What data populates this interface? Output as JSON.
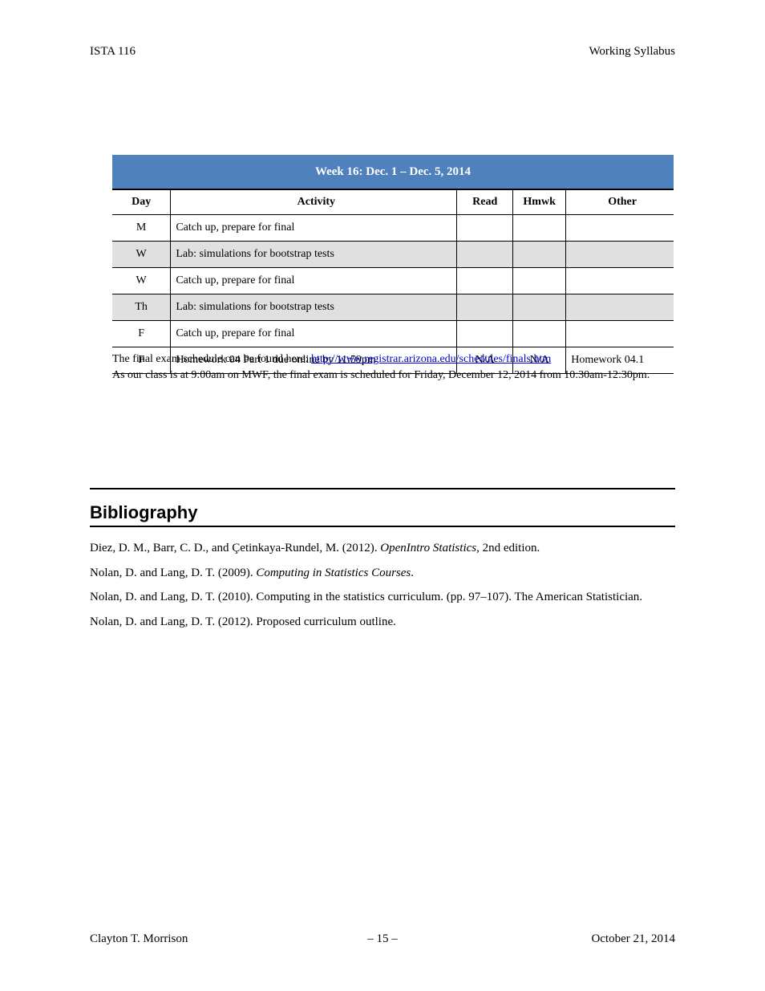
{
  "header": {
    "left": "ISTA 116",
    "right": "Working Syllabus"
  },
  "table": {
    "title": "Week 16: Dec. 1 – Dec. 5, 2014",
    "columns": [
      "Day",
      "Activity",
      "Read",
      "Hmwk",
      "Other"
    ],
    "rows": [
      {
        "day": "M",
        "activity": "Catch up, prepare for final",
        "read": "",
        "hmwk": "",
        "other": "",
        "shade": false
      },
      {
        "day": "W",
        "activity": "Lab: simulations for bootstrap tests",
        "read": "",
        "hmwk": "",
        "other": "",
        "shade": true
      },
      {
        "day": "W",
        "activity": "Catch up, prepare for final",
        "read": "",
        "hmwk": "",
        "other": "",
        "shade": false
      },
      {
        "day": "Th",
        "activity": "Lab: simulations for bootstrap tests",
        "read": "",
        "hmwk": "",
        "other": "",
        "shade": true
      },
      {
        "day": "F",
        "activity": "Catch up, prepare for final",
        "read": "",
        "hmwk": "",
        "other": "",
        "shade": false
      },
      {
        "day": "F",
        "activity": "Homework 04 Part 1 due online by 11:59pm",
        "read": "N/A",
        "hmwk": "N/A",
        "other": "Homework 04.1",
        "shade": false
      }
    ]
  },
  "note": {
    "line1_prefix": "The final exam schedule can be found here: ",
    "line1_link": "http://www.registrar.arizona.edu/schedules/finals.htm",
    "line2": "As our class is at 9:00am on MWF, the final exam is scheduled for Friday, December 12, 2014 from 10:30am-12:30pm."
  },
  "section_title": "Bibliography",
  "bib": {
    "e1_prefix": "Diez, D. M., Barr, C. D., and Çetinkaya-Rundel, M. (2012). ",
    "e1_title": "OpenIntro Statistics",
    "e1_suffix": ", 2nd edition.",
    "e2_prefix": "Nolan, D. and Lang, D. T. (2009). ",
    "e2_title": "Computing in Statistics Courses",
    "e2_suffix": ".",
    "e3": "Nolan, D. and Lang, D. T. (2010). Computing in the statistics curriculum. (pp. 97–107). The American Statistician.",
    "e4": "Nolan, D. and Lang, D. T. (2012). Proposed curriculum outline."
  },
  "footer": {
    "name": "Clayton T. Morrison",
    "page_prefix": "– ",
    "page_suffix": " –",
    "page_number": "15",
    "date": "October 21, 2014"
  }
}
